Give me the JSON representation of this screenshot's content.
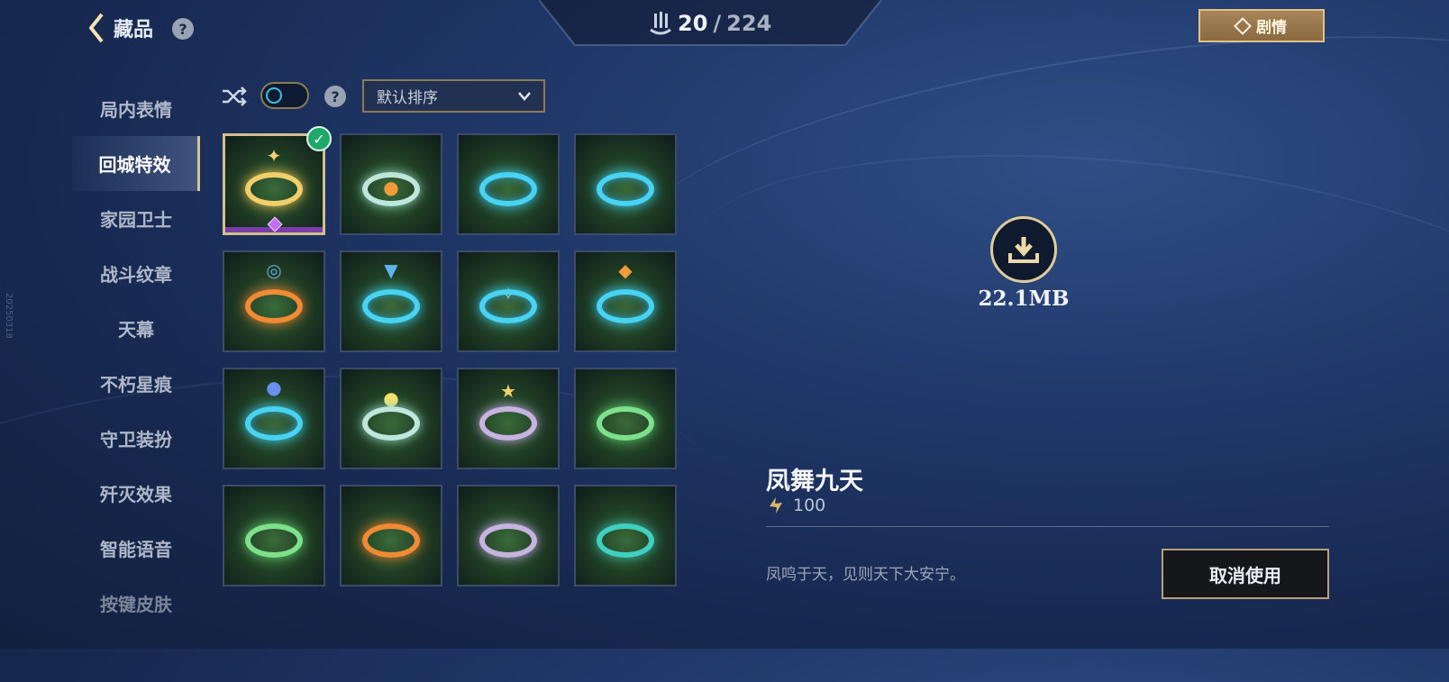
{
  "header": {
    "title": "藏品",
    "collected": "20",
    "separator": "/",
    "total": "224",
    "story_label": "剧情"
  },
  "sidebar": {
    "watermark": "20250318",
    "items": [
      {
        "label": "局内表情"
      },
      {
        "label": "回城特效",
        "active": true
      },
      {
        "label": "家园卫士"
      },
      {
        "label": "战斗纹章"
      },
      {
        "label": "天幕"
      },
      {
        "label": "不朽星痕"
      },
      {
        "label": "守卫装扮"
      },
      {
        "label": "歼灭效果"
      },
      {
        "label": "智能语音"
      },
      {
        "label": "按键皮肤"
      }
    ]
  },
  "toolbar": {
    "shuffle_icon": "shuffle-icon",
    "toggle_on": false,
    "sort_label": "默认排序"
  },
  "grid": {
    "selected_index": 0,
    "tiles": [
      {
        "style": "gold"
      },
      {
        "style": "pale"
      },
      {
        "style": "blue"
      },
      {
        "style": "blue"
      },
      {
        "style": "orange"
      },
      {
        "style": "blue"
      },
      {
        "style": "blue"
      },
      {
        "style": "blue"
      },
      {
        "style": "blue"
      },
      {
        "style": "pale"
      },
      {
        "style": "flower"
      },
      {
        "style": "green"
      },
      {
        "style": "green"
      },
      {
        "style": "teal"
      },
      {
        "style": "flower"
      },
      {
        "style": "teal"
      }
    ]
  },
  "preview": {
    "download_size": "22.1MB",
    "item_name": "凤舞九天",
    "price": "100",
    "description": "凤鸣于天，见则天下大安宁。",
    "action_label": "取消使用"
  },
  "colors": {
    "accent_gold": "#d2bf8c",
    "selected_check": "#1ea86a",
    "background": "#20386a"
  }
}
